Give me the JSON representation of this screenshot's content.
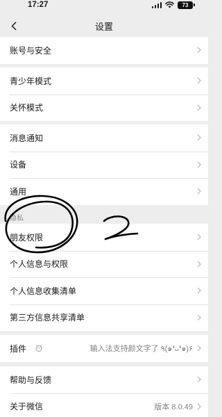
{
  "status_bar": {
    "time": "17:27",
    "battery": "73"
  },
  "nav": {
    "title": "设置"
  },
  "groups": {
    "account": [
      {
        "label": "账号与安全"
      }
    ],
    "modes": [
      {
        "label": "青少年模式"
      },
      {
        "label": "关怀模式"
      }
    ],
    "general": [
      {
        "label": "消息通知"
      },
      {
        "label": "设备"
      },
      {
        "label": "通用"
      }
    ],
    "privacy_header": "隐私",
    "privacy": [
      {
        "label": "朋友权限"
      },
      {
        "label": "个人信息与权限"
      },
      {
        "label": "个人信息收集清单"
      },
      {
        "label": "第三方信息共享清单"
      }
    ],
    "plugins": {
      "label": "插件",
      "value": "输入法支持颜文字了 ٩(๑❛ᴗ❛๑)۶"
    },
    "about": [
      {
        "label": "帮助与反馈"
      },
      {
        "label": "关于微信",
        "value": "版本 8.0.49"
      }
    ]
  },
  "annotation": {
    "handwritten_text": "2"
  },
  "colors": {
    "background": "#ededed",
    "card": "#ffffff",
    "secondary_text": "#808080",
    "ink": "#000000"
  },
  "icons": [
    "back-chevron-icon",
    "signal-icon",
    "wifi-icon",
    "battery-icon",
    "chevron-right-icon",
    "plugin-icon"
  ]
}
